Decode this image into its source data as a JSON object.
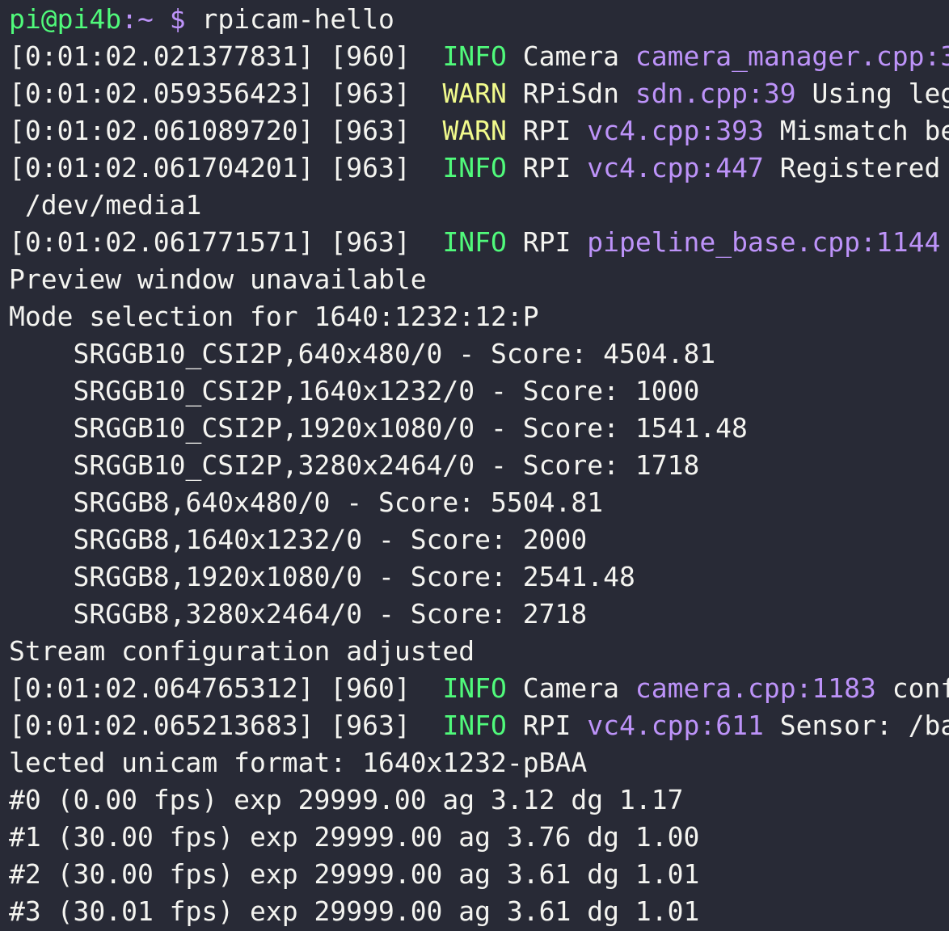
{
  "colors": {
    "background": "#282a36",
    "foreground": "#f4f4f0",
    "info": "#50fa7b",
    "warn": "#f1fa8c",
    "source": "#bd93f9"
  },
  "prompt": {
    "user_host": "pi@pi4b",
    "separator": ":",
    "path": "~",
    "symbol": "$",
    "command": "rpicam-hello"
  },
  "log": [
    {
      "prefix": "[0:01:02.021377831] [960]  ",
      "level": "INFO",
      "category": "Camera",
      "source": "camera_manager.cpp:3",
      "message": ""
    },
    {
      "prefix": "[0:01:02.059356423] [963]  ",
      "level": "WARN",
      "category": "RPiSdn",
      "source": "sdn.cpp:39",
      "message": "Using leg"
    },
    {
      "prefix": "[0:01:02.061089720] [963]  ",
      "level": "WARN",
      "category": "RPI",
      "source": "vc4.cpp:393",
      "message": "Mismatch be"
    },
    {
      "prefix": "[0:01:02.061704201] [963]  ",
      "level": "INFO",
      "category": "RPI",
      "source": "vc4.cpp:447",
      "message": "Registered"
    }
  ],
  "wrap_media": " /dev/media1",
  "log2": {
    "prefix": "[0:01:02.061771571] [963]  ",
    "level": "INFO",
    "category": "RPI",
    "source": "pipeline_base.cpp:1144",
    "message": ""
  },
  "preview_line": "Preview window unavailable",
  "mode_header": "Mode selection for 1640:1232:12:P",
  "modes": [
    "    SRGGB10_CSI2P,640x480/0 - Score: 4504.81",
    "    SRGGB10_CSI2P,1640x1232/0 - Score: 1000",
    "    SRGGB10_CSI2P,1920x1080/0 - Score: 1541.48",
    "    SRGGB10_CSI2P,3280x2464/0 - Score: 1718",
    "    SRGGB8,640x480/0 - Score: 5504.81",
    "    SRGGB8,1640x1232/0 - Score: 2000",
    "    SRGGB8,1920x1080/0 - Score: 2541.48",
    "    SRGGB8,3280x2464/0 - Score: 2718"
  ],
  "stream_line": "Stream configuration adjusted",
  "log3": [
    {
      "prefix": "[0:01:02.064765312] [960]  ",
      "level": "INFO",
      "category": "Camera",
      "source": "camera.cpp:1183",
      "message": "conf"
    },
    {
      "prefix": "[0:01:02.065213683] [963]  ",
      "level": "INFO",
      "category": "RPI",
      "source": "vc4.cpp:611",
      "message": "Sensor: /ba"
    }
  ],
  "wrap_unicam": "lected unicam format: 1640x1232-pBAA",
  "frames": [
    "#0 (0.00 fps) exp 29999.00 ag 3.12 dg 1.17",
    "#1 (30.00 fps) exp 29999.00 ag 3.76 dg 1.00",
    "#2 (30.00 fps) exp 29999.00 ag 3.61 dg 1.01",
    "#3 (30.01 fps) exp 29999.00 ag 3.61 dg 1.01"
  ]
}
